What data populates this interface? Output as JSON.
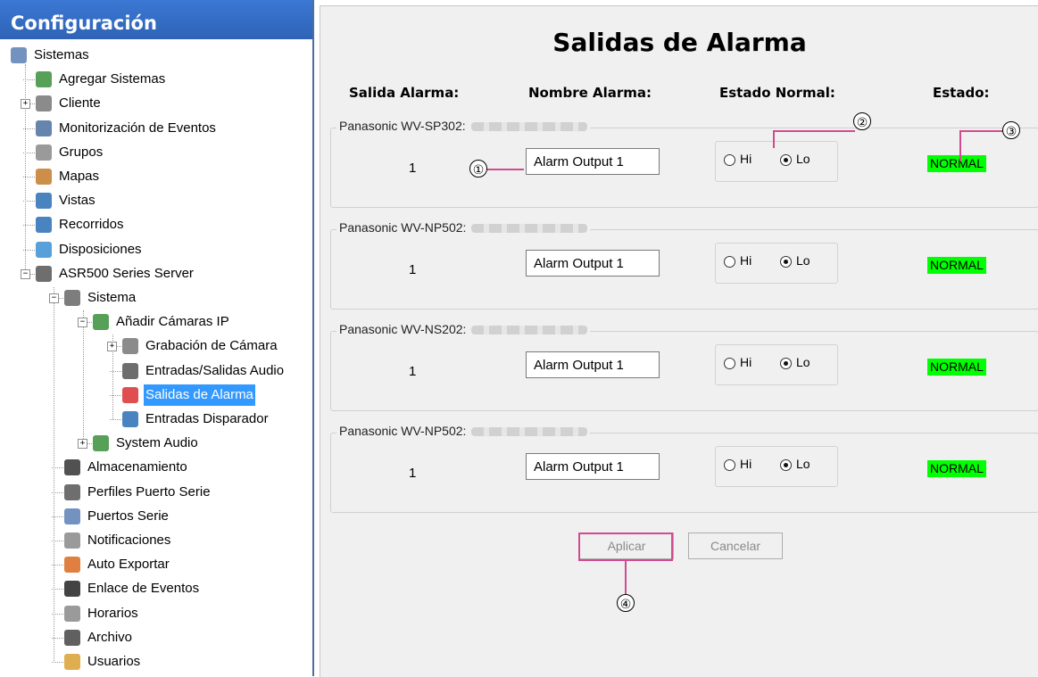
{
  "sidebar": {
    "title": "Configuración",
    "items": [
      {
        "label": "Sistemas",
        "icon": "systems-icon"
      },
      {
        "label": "Agregar Sistemas",
        "icon": "add-system-icon"
      },
      {
        "label": "Cliente",
        "icon": "client-gear-icon"
      },
      {
        "label": "Monitorización de Eventos",
        "icon": "event-monitor-icon"
      },
      {
        "label": "Grupos",
        "icon": "groups-icon"
      },
      {
        "label": "Mapas",
        "icon": "maps-icon"
      },
      {
        "label": "Vistas",
        "icon": "views-icon"
      },
      {
        "label": "Recorridos",
        "icon": "tours-icon"
      },
      {
        "label": "Disposiciones",
        "icon": "layouts-icon"
      },
      {
        "label": "ASR500 Series Server",
        "icon": "server-icon"
      },
      {
        "label": "Sistema",
        "icon": "system-icon"
      },
      {
        "label": "Añadir Cámaras IP",
        "icon": "add-camera-icon"
      },
      {
        "label": "Grabación de Cámara",
        "icon": "camera-recording-icon"
      },
      {
        "label": "Entradas/Salidas Audio",
        "icon": "audio-io-icon"
      },
      {
        "label": "Salidas de Alarma",
        "icon": "alarm-output-icon"
      },
      {
        "label": "Entradas Disparador",
        "icon": "trigger-input-icon"
      },
      {
        "label": "System Audio",
        "icon": "system-audio-icon"
      },
      {
        "label": "Almacenamiento",
        "icon": "storage-icon"
      },
      {
        "label": "Perfiles Puerto Serie",
        "icon": "serial-profile-icon"
      },
      {
        "label": "Puertos Serie",
        "icon": "serial-port-icon"
      },
      {
        "label": "Notificaciones",
        "icon": "notification-icon"
      },
      {
        "label": "Auto Exportar",
        "icon": "auto-export-icon"
      },
      {
        "label": "Enlace de Eventos",
        "icon": "event-link-icon"
      },
      {
        "label": "Horarios",
        "icon": "schedule-icon"
      },
      {
        "label": "Archivo",
        "icon": "archive-icon"
      },
      {
        "label": "Usuarios",
        "icon": "users-icon"
      }
    ],
    "selected": "Salidas de Alarma"
  },
  "main": {
    "title": "Salidas de Alarma",
    "columns": {
      "output": "Salida Alarma:",
      "name": "Nombre Alarma:",
      "normal_state": "Estado Normal:",
      "state": "Estado:"
    },
    "devices": [
      {
        "device": "Panasonic WV-SP302:",
        "output": "1",
        "name": "Alarm Output 1",
        "hi": "Hi",
        "lo": "Lo",
        "selected": "Lo",
        "status": "NORMAL"
      },
      {
        "device": "Panasonic WV-NP502:",
        "output": "1",
        "name": "Alarm Output 1",
        "hi": "Hi",
        "lo": "Lo",
        "selected": "Lo",
        "status": "NORMAL"
      },
      {
        "device": "Panasonic WV-NS202:",
        "output": "1",
        "name": "Alarm Output 1",
        "hi": "Hi",
        "lo": "Lo",
        "selected": "Lo",
        "status": "NORMAL"
      },
      {
        "device": "Panasonic WV-NP502:",
        "output": "1",
        "name": "Alarm Output 1",
        "hi": "Hi",
        "lo": "Lo",
        "selected": "Lo",
        "status": "NORMAL"
      }
    ],
    "buttons": {
      "apply": "Aplicar",
      "cancel": "Cancelar"
    },
    "callouts": [
      "①",
      "②",
      "③",
      "④"
    ]
  },
  "colors": {
    "status_bg": "#00ff00",
    "callout_line": "#d14b8f",
    "selected_bg": "#3399ff",
    "header_bg": "#2e63b7"
  }
}
